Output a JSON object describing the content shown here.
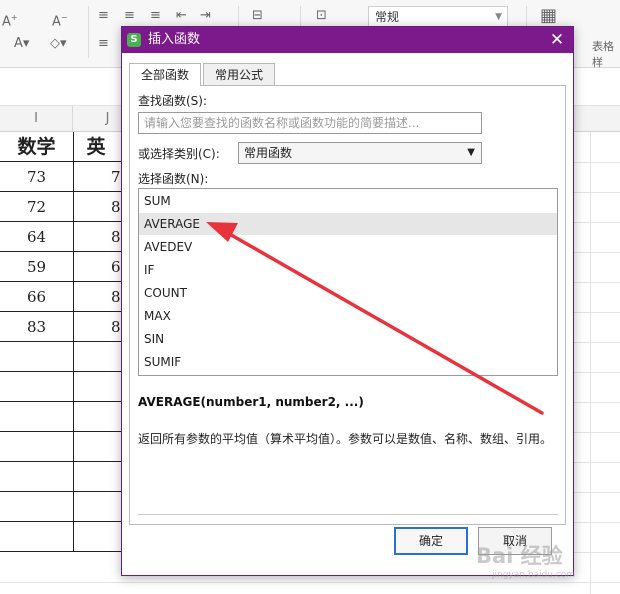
{
  "ribbon": {
    "number_format": "常规",
    "table_style_label": "表格样"
  },
  "sheet": {
    "column_headers": [
      "I",
      "J"
    ],
    "table": {
      "headers": [
        "数学",
        "英"
      ],
      "rows": [
        [
          "73",
          "7"
        ],
        [
          "72",
          "8"
        ],
        [
          "64",
          "8"
        ],
        [
          "59",
          "6"
        ],
        [
          "66",
          "8"
        ],
        [
          "83",
          "8"
        ]
      ]
    }
  },
  "dialog": {
    "title": "插入函数",
    "tabs": [
      {
        "label": "全部函数",
        "active": true
      },
      {
        "label": "常用公式",
        "active": false
      }
    ],
    "search_label": "查找函数(S):",
    "search_placeholder": "请输入您要查找的函数名称或函数功能的简要描述...",
    "category_label": "或选择类别(C):",
    "category_value": "常用函数",
    "function_list_label": "选择函数(N):",
    "functions": [
      "SUM",
      "AVERAGE",
      "AVEDEV",
      "IF",
      "COUNT",
      "MAX",
      "SIN",
      "SUMIF"
    ],
    "selected_function": "AVERAGE",
    "syntax": "AVERAGE(number1, number2, ...)",
    "description": "返回所有参数的平均值（算术平均值）。参数可以是数值、名称、数组、引用。",
    "ok_label": "确定",
    "cancel_label": "取消"
  },
  "colors": {
    "titlebar": "#7d1a8b",
    "annotation_arrow": "#e8323c",
    "ok_border": "#2a6fd6"
  },
  "watermark": {
    "text": "Bai 经验",
    "subtext": "jingyan.baidu.com"
  }
}
